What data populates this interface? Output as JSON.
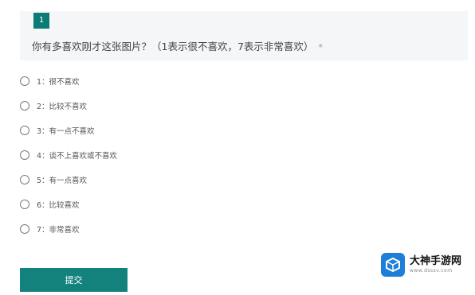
{
  "question": {
    "number": "1",
    "title": "你有多喜欢刚才这张图片？（1表示很不喜欢，7表示非常喜欢）",
    "required_mark": "*"
  },
  "options": [
    {
      "label": "1：很不喜欢"
    },
    {
      "label": "2：比较不喜欢"
    },
    {
      "label": "3：有一点不喜欢"
    },
    {
      "label": "4：谈不上喜欢或不喜欢"
    },
    {
      "label": "5：有一点喜欢"
    },
    {
      "label": "6：比较喜欢"
    },
    {
      "label": "7：非常喜欢"
    }
  ],
  "submit_label": "提交",
  "watermark": {
    "name": "大神手游网",
    "url": "www.dsssv.com",
    "icon": "cube-icon"
  },
  "colors": {
    "accent": "#13827c",
    "card_bg": "#f4f6f8",
    "watermark_blue": "#1e7fd8"
  }
}
